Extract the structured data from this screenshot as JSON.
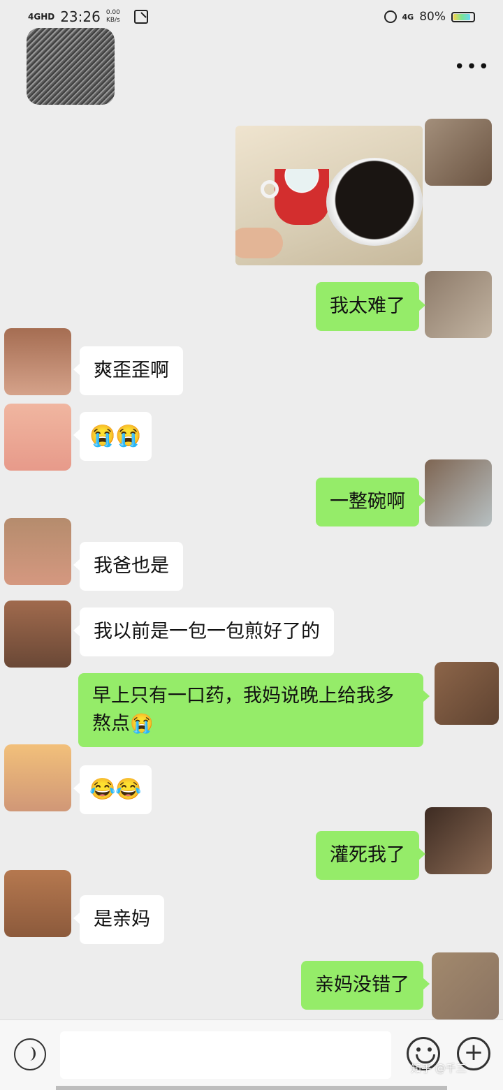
{
  "status_bar": {
    "network": "4GHD",
    "time": "23:26",
    "speed_value": "0.00",
    "speed_unit": "KB/s",
    "net_right": "4G",
    "battery": "80%"
  },
  "header": {
    "more_label": "•••"
  },
  "messages": [
    {
      "side": "out",
      "type": "image",
      "alt": ""
    },
    {
      "side": "out",
      "text": "我太难了"
    },
    {
      "side": "in",
      "text": "爽歪歪啊"
    },
    {
      "side": "in",
      "text": "😭😭"
    },
    {
      "side": "out",
      "text": "一整碗啊"
    },
    {
      "side": "in",
      "text": "我爸也是"
    },
    {
      "side": "in",
      "text": "我以前是一包一包煎好了的"
    },
    {
      "side": "out",
      "text": "早上只有一口药，我妈说晚上给我多熬点😭"
    },
    {
      "side": "in",
      "text": "😂😂"
    },
    {
      "side": "out",
      "text": "灌死我了"
    },
    {
      "side": "in",
      "text": "是亲妈"
    },
    {
      "side": "out",
      "text": "亲妈没错了"
    }
  ],
  "input": {
    "placeholder": ""
  },
  "watermark": "知乎 @千三",
  "colors": {
    "background": "#ededed",
    "outgoing_bubble": "#95ec69",
    "incoming_bubble": "#ffffff"
  },
  "icons": {
    "voice": "voice-icon",
    "emoji": "emoji-icon",
    "plus": "plus-icon",
    "more": "more-icon"
  }
}
